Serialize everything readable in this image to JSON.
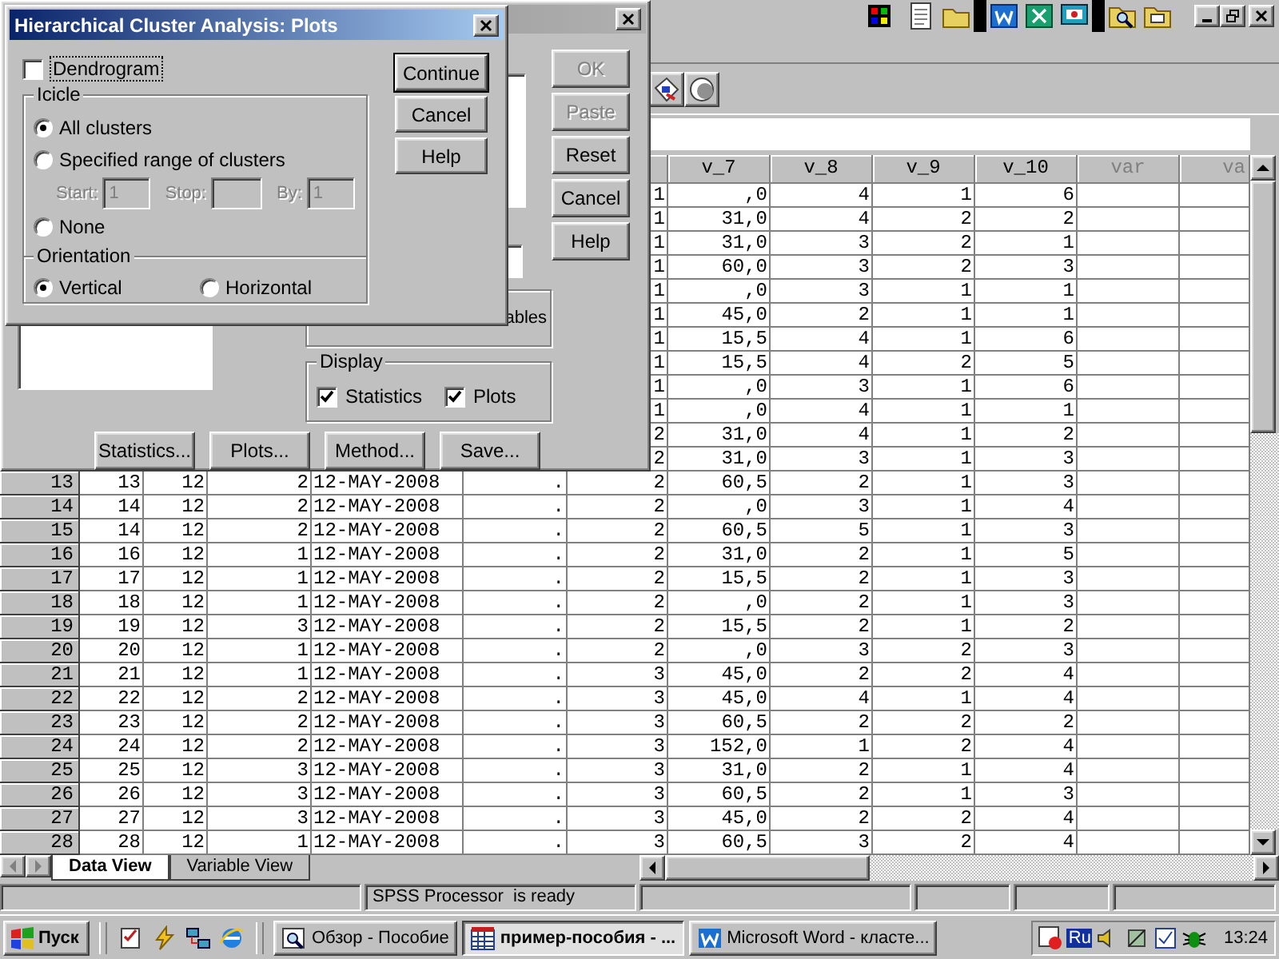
{
  "plots_dialog": {
    "title": "Hierarchical Cluster Analysis: Plots",
    "dendrogram": {
      "label": "Dendrogram",
      "checked": false
    },
    "icicle": {
      "title": "Icicle",
      "options": [
        {
          "label": "All clusters",
          "selected": true
        },
        {
          "label": "Specified range of clusters",
          "selected": false
        },
        {
          "label": "None",
          "selected": false
        }
      ],
      "range_disabled": true,
      "range_fields": [
        {
          "label": "Start:",
          "value": "1"
        },
        {
          "label": "Stop:"
        },
        {
          "label": "By:",
          "value": "1"
        }
      ]
    },
    "orientation": {
      "title": "Orientation",
      "options": [
        {
          "label": "Vertical",
          "selected": true
        },
        {
          "label": "Horizontal",
          "selected": false
        }
      ]
    },
    "buttons": [
      {
        "label": "Continue",
        "default": true
      },
      {
        "label": "Cancel",
        "default": false
      },
      {
        "label": "Help",
        "default": false
      }
    ]
  },
  "cluster_dialog": {
    "buttons": [
      {
        "label": "OK",
        "disabled": true
      },
      {
        "label": "Paste",
        "disabled": true
      },
      {
        "label": "Reset",
        "disabled": false
      },
      {
        "label": "Cancel",
        "disabled": false
      },
      {
        "label": "Help",
        "disabled": false
      }
    ],
    "cluster_option_label": "ables",
    "display": {
      "title": "Display",
      "options": [
        {
          "label": "Statistics",
          "checked": true
        },
        {
          "label": "Plots",
          "checked": true
        }
      ]
    },
    "bottom_buttons": [
      "Statistics...",
      "Plots...",
      "Method...",
      "Save..."
    ]
  },
  "grid": {
    "columns": [
      {
        "label": "v_7",
        "kind": "variable"
      },
      {
        "label": "v_8",
        "kind": "variable"
      },
      {
        "label": "v_9",
        "kind": "variable"
      },
      {
        "label": "v_10",
        "kind": "variable"
      },
      {
        "label": "var",
        "kind": "empty"
      },
      {
        "label": "va",
        "kind": "empty"
      }
    ],
    "rows": [
      {
        "values": [
          "1",
          ",0",
          "4",
          "1",
          "6"
        ]
      },
      {
        "values": [
          "1",
          "31,0",
          "4",
          "2",
          "2"
        ]
      },
      {
        "values": [
          "1",
          "31,0",
          "3",
          "2",
          "1"
        ]
      },
      {
        "values": [
          "1",
          "60,0",
          "3",
          "2",
          "3"
        ]
      },
      {
        "values": [
          "1",
          ",0",
          "3",
          "1",
          "1"
        ]
      },
      {
        "values": [
          "1",
          "45,0",
          "2",
          "1",
          "1"
        ]
      },
      {
        "values": [
          "1",
          "15,5",
          "4",
          "1",
          "6"
        ]
      },
      {
        "values": [
          "1",
          "15,5",
          "4",
          "2",
          "5"
        ]
      },
      {
        "values": [
          "1",
          ",0",
          "3",
          "1",
          "6"
        ]
      },
      {
        "values": [
          "1",
          ",0",
          "4",
          "1",
          "1"
        ]
      },
      {
        "values": [
          "2",
          "31,0",
          "4",
          "1",
          "2"
        ]
      },
      {
        "values": [
          "2",
          "31,0",
          "3",
          "1",
          "3"
        ]
      },
      {
        "row": "13",
        "values": [
          "13",
          "12",
          "2",
          "12-MAY-2008",
          ".",
          "2",
          "60,5",
          "2",
          "1",
          "3"
        ]
      },
      {
        "row": "14",
        "values": [
          "14",
          "12",
          "2",
          "12-MAY-2008",
          ".",
          "2",
          ",0",
          "3",
          "1",
          "4"
        ]
      },
      {
        "row": "15",
        "values": [
          "14",
          "12",
          "2",
          "12-MAY-2008",
          ".",
          "2",
          "60,5",
          "5",
          "1",
          "3"
        ]
      },
      {
        "row": "16",
        "values": [
          "16",
          "12",
          "1",
          "12-MAY-2008",
          ".",
          "2",
          "31,0",
          "2",
          "1",
          "5"
        ]
      },
      {
        "row": "17",
        "values": [
          "17",
          "12",
          "1",
          "12-MAY-2008",
          ".",
          "2",
          "15,5",
          "2",
          "1",
          "3"
        ]
      },
      {
        "row": "18",
        "values": [
          "18",
          "12",
          "1",
          "12-MAY-2008",
          ".",
          "2",
          ",0",
          "2",
          "1",
          "3"
        ]
      },
      {
        "row": "19",
        "values": [
          "19",
          "12",
          "3",
          "12-MAY-2008",
          ".",
          "2",
          "15,5",
          "2",
          "1",
          "2"
        ]
      },
      {
        "row": "20",
        "values": [
          "20",
          "12",
          "1",
          "12-MAY-2008",
          ".",
          "2",
          ",0",
          "3",
          "2",
          "3"
        ]
      },
      {
        "row": "21",
        "values": [
          "21",
          "12",
          "1",
          "12-MAY-2008",
          ".",
          "3",
          "45,0",
          "2",
          "2",
          "4"
        ]
      },
      {
        "row": "22",
        "values": [
          "22",
          "12",
          "2",
          "12-MAY-2008",
          ".",
          "3",
          "45,0",
          "4",
          "1",
          "4"
        ]
      },
      {
        "row": "23",
        "values": [
          "23",
          "12",
          "2",
          "12-MAY-2008",
          ".",
          "3",
          "60,5",
          "2",
          "2",
          "2"
        ]
      },
      {
        "row": "24",
        "values": [
          "24",
          "12",
          "2",
          "12-MAY-2008",
          ".",
          "3",
          "152,0",
          "1",
          "2",
          "4"
        ]
      },
      {
        "row": "25",
        "values": [
          "25",
          "12",
          "3",
          "12-MAY-2008",
          ".",
          "3",
          "31,0",
          "2",
          "1",
          "4"
        ]
      },
      {
        "row": "26",
        "values": [
          "26",
          "12",
          "3",
          "12-MAY-2008",
          ".",
          "3",
          "60,5",
          "2",
          "1",
          "3"
        ]
      },
      {
        "row": "27",
        "values": [
          "27",
          "12",
          "3",
          "12-MAY-2008",
          ".",
          "3",
          "45,0",
          "2",
          "2",
          "4"
        ]
      },
      {
        "row": "28",
        "values": [
          "28",
          "12",
          "1",
          "12-MAY-2008",
          ".",
          "3",
          "60,5",
          "3",
          "2",
          "4"
        ]
      }
    ]
  },
  "view_tabs": [
    {
      "label": "Data View",
      "selected": true
    },
    {
      "label": "Variable View",
      "selected": false
    }
  ],
  "status_bar": {
    "message": "SPSS Processor  is ready"
  },
  "taskbar": {
    "start_label": "Пуск",
    "tasks": [
      {
        "label": "Обзор - Пособие",
        "kind": "explorer",
        "selected": false
      },
      {
        "label": "пример-пособия - ...",
        "kind": "spss",
        "selected": true
      },
      {
        "label": "Microsoft Word - класте...",
        "kind": "word",
        "selected": false
      }
    ],
    "tray_language": "Ru",
    "clock": "13:24"
  }
}
